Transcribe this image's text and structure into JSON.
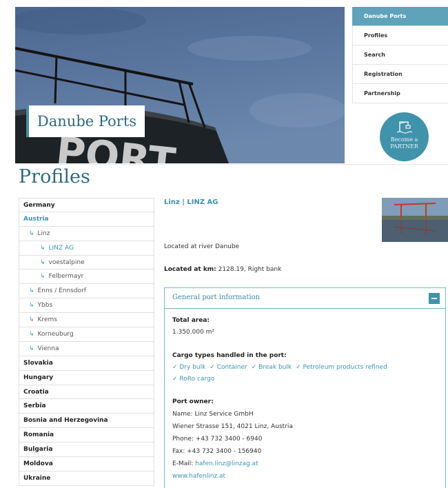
{
  "hero": {
    "title": "Danube Ports",
    "tower_text": "PORT"
  },
  "nav": {
    "items": [
      "Danube Ports",
      "Profiles",
      "Search",
      "Registration",
      "Partnership"
    ],
    "active_index": 0
  },
  "partner": {
    "line1": "Become a",
    "line2": "PARTNER"
  },
  "page": {
    "title": "Profiles"
  },
  "sidebar": {
    "rows": [
      {
        "label": "Germany",
        "level": 0
      },
      {
        "label": "Austria",
        "level": 0,
        "active": true
      },
      {
        "label": "Linz",
        "level": 1
      },
      {
        "label": "LINZ AG",
        "level": 2,
        "current": true
      },
      {
        "label": "voestalpine",
        "level": 2
      },
      {
        "label": "Felbermayr",
        "level": 2
      },
      {
        "label": "Enns / Ennsdorf",
        "level": 1
      },
      {
        "label": "Ybbs",
        "level": 1
      },
      {
        "label": "Krems",
        "level": 1
      },
      {
        "label": "Korneuburg",
        "level": 1
      },
      {
        "label": "Vienna",
        "level": 1
      },
      {
        "label": "Slovakia",
        "level": 0
      },
      {
        "label": "Hungary",
        "level": 0
      },
      {
        "label": "Croatia",
        "level": 0
      },
      {
        "label": "Serbia",
        "level": 0
      },
      {
        "label": "Bosnia and Herzegovina",
        "level": 0
      },
      {
        "label": "Romania",
        "level": 0
      },
      {
        "label": "Bulgaria",
        "level": 0
      },
      {
        "label": "Moldova",
        "level": 0
      },
      {
        "label": "Ukraine",
        "level": 0
      }
    ]
  },
  "port": {
    "name": "Linz | LINZ AG",
    "located_text": "Located at river Danube",
    "km_label": "Located at km:",
    "km_value": "2128.19, Right bank"
  },
  "panel": {
    "title": "General port information",
    "total_area_label": "Total area:",
    "total_area_value": "1.350.000 m²",
    "cargo_label": "Cargo types handled in the port:",
    "cargo_types": [
      "Dry bulk",
      "Container",
      "Break bulk",
      "Petroleum products refined",
      "RoRo cargo"
    ],
    "owner_label": "Port owner:",
    "owner_name": "Name:  Linz Service GmbH",
    "owner_address": "Wiener Strasse 151, 4021 Linz, Austria",
    "owner_phone": "Phone:  +43 732 3400 - 6940",
    "owner_fax": "Fax:  +43 732 3400 - 156940",
    "email_label": "E-Mail:",
    "email": "hafen.linz@linzag.at",
    "website": "www.hafenlinz.at"
  },
  "colors": {
    "accent": "#3c94b0",
    "nav_active": "#5fa3ba",
    "partner_badge": "#3f93aa"
  }
}
